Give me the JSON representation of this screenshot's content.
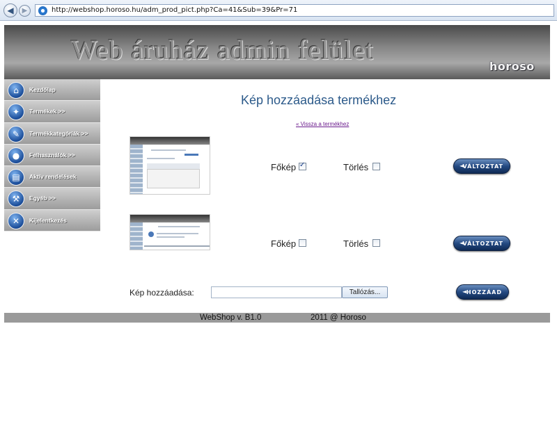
{
  "browser": {
    "url": "http://webshop.horoso.hu/adm_prod_pict.php?Ca=41&Sub=39&Pr=71"
  },
  "header": {
    "title": "Web áruház admin felület",
    "logo": "horoso"
  },
  "sidebar": {
    "items": [
      {
        "label": "Kezdőlap",
        "icon": "home-icon"
      },
      {
        "label": "Termékek >>",
        "icon": "lightbulb-icon"
      },
      {
        "label": "Termékkategóriák >>",
        "icon": "pen-icon"
      },
      {
        "label": "Felhasználók >>",
        "icon": "user-icon"
      },
      {
        "label": "Aktív rendelések",
        "icon": "cart-icon"
      },
      {
        "label": "Egyéb >>",
        "icon": "wrench-icon"
      },
      {
        "label": "Kijelentkezés",
        "icon": "close-icon"
      }
    ]
  },
  "main": {
    "title": "Kép hozzáadása termékhez",
    "back_link": "« Vissza a termékhez",
    "pictures": [
      {
        "main_label": "Főkép",
        "main_checked": true,
        "delete_label": "Törlés",
        "delete_checked": false,
        "button_label": "VÁLTOZTAT"
      },
      {
        "main_label": "Főkép",
        "main_checked": false,
        "delete_label": "Törlés",
        "delete_checked": false,
        "button_label": "VÁLTOZTAT"
      }
    ],
    "add": {
      "label": "Kép hozzáadása:",
      "file_value": "",
      "browse_label": "Tallózás...",
      "button_label": "HOZZÁAD"
    }
  },
  "footer": {
    "version": "WebShop v. B1.0",
    "copyright": "2011 @ Horoso"
  },
  "colors": {
    "title": "#2c5a8a",
    "button": "#244a82",
    "footer": "#9a9a9a"
  }
}
